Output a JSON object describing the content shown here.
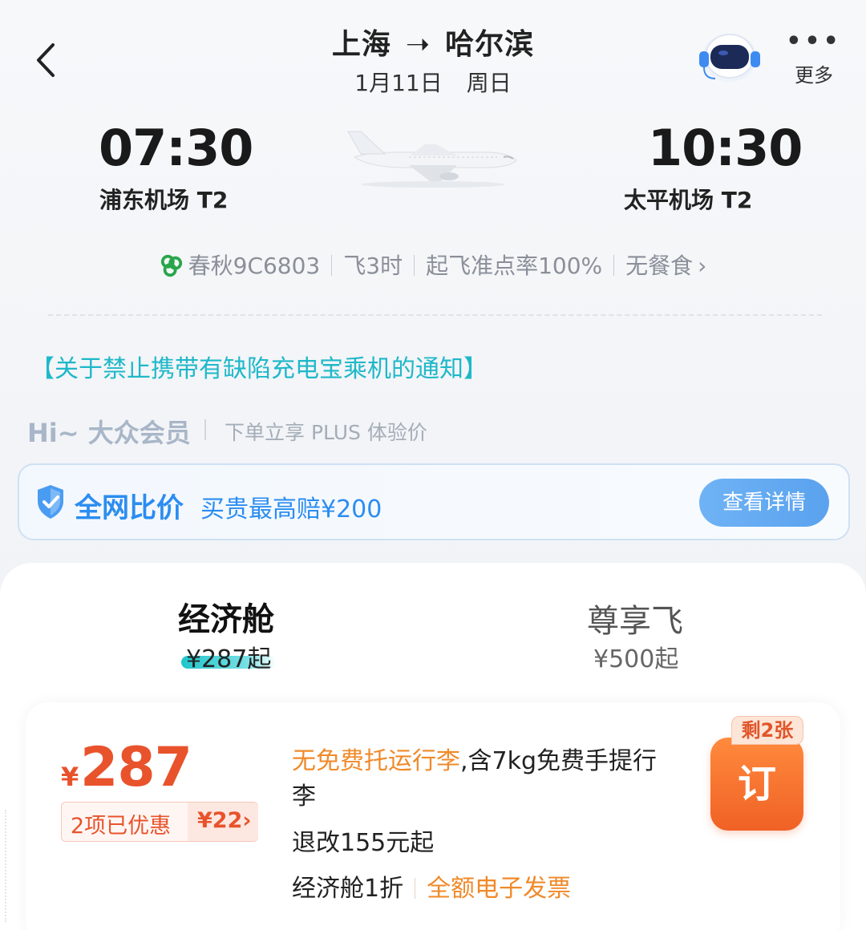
{
  "header": {
    "from": "上海",
    "to": "哈尔滨",
    "arrow": "➝",
    "date": "1月11日",
    "weekday": "周日",
    "more_dots": "•••",
    "more_label": "更多"
  },
  "flight": {
    "dep_time": "07:30",
    "dep_airport": "浦东机场 T2",
    "arr_time": "10:30",
    "arr_airport": "太平机场 T2",
    "airline": "春秋9C6803",
    "duration": "飞3时",
    "on_time_rate": "起飞准点率100%",
    "meal": "无餐食",
    "meal_chevron": "›"
  },
  "notice": "【关于禁止携带有缺陷充电宝乘机的通知】",
  "member": {
    "greeting": "Hi~ 大众会员",
    "desc": "下单立享 PLUS 体验价"
  },
  "compare": {
    "title": "全网比价",
    "desc": "买贵最高赔¥200",
    "button": "查看详情"
  },
  "cabin_tabs": [
    {
      "name": "经济舱",
      "price": "¥287起",
      "active": true
    },
    {
      "name": "尊享飞",
      "price": "¥500起",
      "active": false
    }
  ],
  "fare": {
    "currency": "¥",
    "price": "287",
    "discount_label": "2项已优惠",
    "discount_amount": "¥22›",
    "baggage_highlight": "无免费托运行李",
    "baggage_rest": ",含7kg免费手提行李",
    "change": "退改155元起",
    "cabin_discount": "经济舱1折",
    "invoice": "全额电子发票",
    "book_label": "订",
    "remaining": "剩2张"
  },
  "colors": {
    "accent_teal": "#1fb8c9",
    "accent_blue": "#2b8df0",
    "price_orange": "#e8532c",
    "book_orange": "#f06125"
  }
}
